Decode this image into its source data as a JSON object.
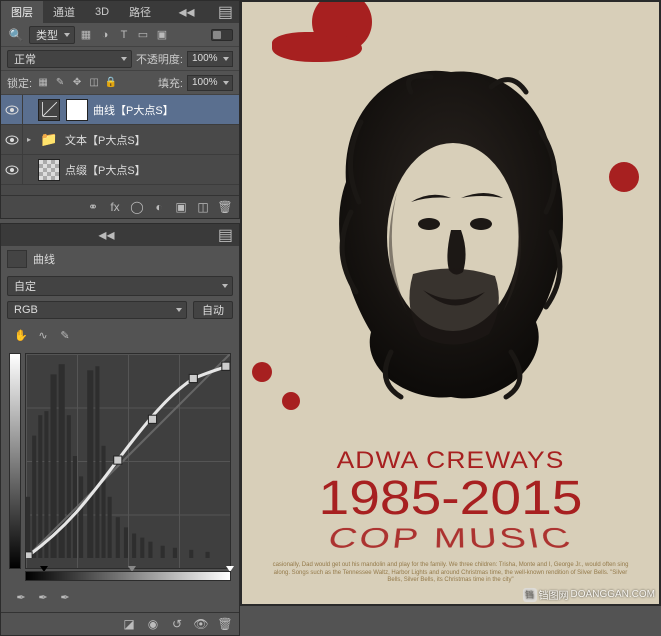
{
  "layers_panel": {
    "tabs": [
      "图层",
      "通道",
      "3D",
      "路径"
    ],
    "active_tab": 0,
    "filter": {
      "kind_label": "类型"
    },
    "blend": {
      "mode": "正常",
      "opacity_label": "不透明度:",
      "opacity_value": "100%"
    },
    "lock": {
      "label": "锁定:",
      "fill_label": "填充:",
      "fill_value": "100%"
    },
    "layers": [
      {
        "name": "曲线【P大点S】",
        "type": "curves",
        "has_mask": true,
        "selected": true,
        "visible": true
      },
      {
        "name": "文本【P大点S】",
        "type": "folder",
        "selected": false,
        "visible": true
      },
      {
        "name": "点缀【P大点S】",
        "type": "pixel",
        "selected": false,
        "visible": true
      }
    ]
  },
  "curves_panel": {
    "title": "曲线",
    "preset": "自定",
    "channel": "RGB",
    "auto_label": "自动"
  },
  "poster": {
    "name": "ADWA CREWAYS",
    "years": "1985-2015",
    "sub": "COP MUSIC",
    "fine": "casionally, Dad would get out his mandolin and play for the family. We three children: Trisha, Monte and I, George Jr., would often sing along. Songs such as the Tennessee Waltz, Harbor Lights and around Christmas time, the well-known rendition of Silver Bells. \"Silver Bells, Silver Bells, its Christmas time in the city\""
  },
  "watermark": {
    "site": "铛图网",
    "url": "DOANGGAN.COM"
  }
}
